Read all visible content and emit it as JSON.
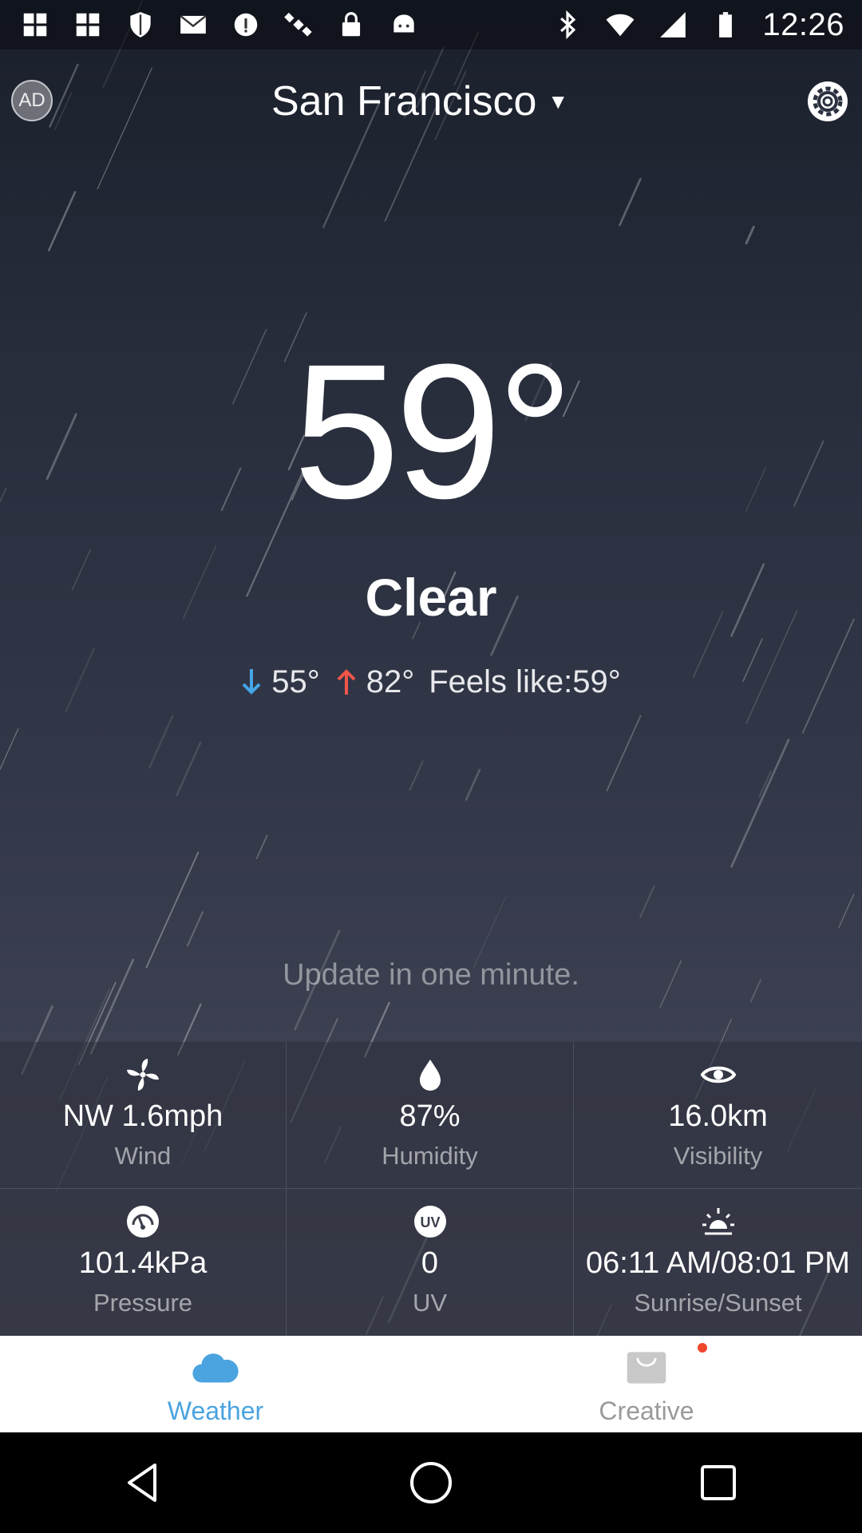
{
  "status_bar": {
    "time": "12:26",
    "left_icons": [
      "grid-icon",
      "grid-icon",
      "shield-icon",
      "mail-icon",
      "info-icon",
      "satellite-icon",
      "lock-icon",
      "android-icon"
    ],
    "right_icons": [
      "bluetooth-icon",
      "wifi-icon",
      "cell-signal-icon",
      "battery-icon"
    ]
  },
  "header": {
    "ad_label": "AD",
    "city": "San Francisco",
    "caret": "▼"
  },
  "current": {
    "temperature": "59°",
    "condition": "Clear",
    "low": "55°",
    "high": "82°",
    "feels_like": "Feels like:59°",
    "update_text": "Update in one minute."
  },
  "details": [
    {
      "icon": "wind-fan-icon",
      "value": "NW 1.6mph",
      "label": "Wind"
    },
    {
      "icon": "drop-icon",
      "value": "87%",
      "label": "Humidity"
    },
    {
      "icon": "eye-icon",
      "value": "16.0km",
      "label": "Visibility"
    },
    {
      "icon": "gauge-icon",
      "value": "101.4kPa",
      "label": "Pressure"
    },
    {
      "icon": "uv-icon",
      "value": "0",
      "label": "UV",
      "icon_text": "UV"
    },
    {
      "icon": "sunrise-icon",
      "value": "06:11 AM/08:01 PM",
      "label": "Sunrise/Sunset"
    }
  ],
  "tabs": [
    {
      "label": "Weather",
      "icon": "cloud-icon",
      "active": true
    },
    {
      "label": "Creative",
      "icon": "bag-icon",
      "active": false,
      "notification": true
    }
  ],
  "colors": {
    "accent": "#4ba3e0",
    "low_arrow": "#45a6e8",
    "high_arrow": "#f0554a",
    "notification": "#f1452e"
  }
}
